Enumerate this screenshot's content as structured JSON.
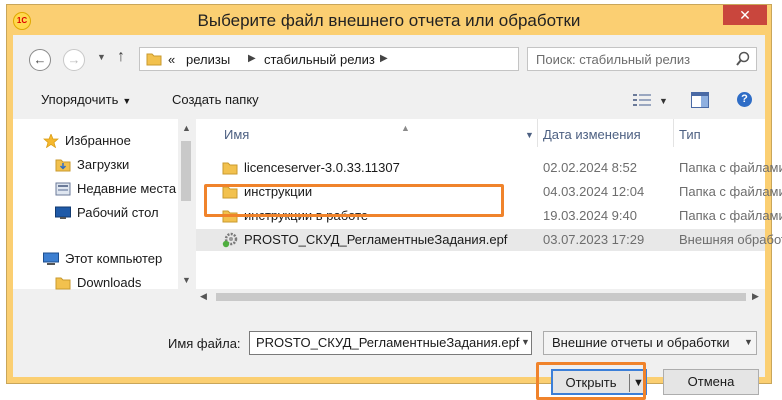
{
  "window": {
    "title": "Выберите файл внешнего отчета или обработки",
    "app_icon_text": "1С",
    "close_symbol": "✕"
  },
  "address_bar": {
    "overflow": "«",
    "segments": [
      "релизы",
      "стабильный релиз"
    ]
  },
  "search": {
    "placeholder": "Поиск: стабильный релиз"
  },
  "toolbar": {
    "organize_label": "Упорядочить",
    "new_folder_label": "Создать папку",
    "help_symbol": "?"
  },
  "nav_pane": {
    "items": [
      {
        "label": "Избранное",
        "icon": "star-icon"
      },
      {
        "label": "Загрузки",
        "icon": "downloads-folder-icon"
      },
      {
        "label": "Недавние места",
        "icon": "recent-places-icon"
      },
      {
        "label": "Рабочий стол",
        "icon": "desktop-icon"
      },
      {
        "label": "Этот компьютер",
        "icon": "computer-icon"
      },
      {
        "label": "Downloads",
        "icon": "folder-icon"
      }
    ]
  },
  "file_list": {
    "columns": {
      "name": "Имя",
      "date": "Дата изменения",
      "type": "Тип"
    },
    "rows": [
      {
        "name": "licenceserver-3.0.33.11307",
        "date": "02.02.2024 8:52",
        "type": "Папка с файлами",
        "icon": "folder-icon",
        "selected": false
      },
      {
        "name": "инструкции",
        "date": "04.03.2024 12:04",
        "type": "Папка с файлами",
        "icon": "folder-icon",
        "selected": false
      },
      {
        "name": "инструкции в работе",
        "date": "19.03.2024 9:40",
        "type": "Папка с файлами",
        "icon": "folder-icon",
        "selected": false
      },
      {
        "name": "PROSTO_СКУД_РегламентныеЗадания.epf",
        "date": "03.07.2023 17:29",
        "type": "Внешняя обработка",
        "icon": "epf-file-icon",
        "selected": true
      }
    ]
  },
  "bottom": {
    "filename_label": "Имя файла:",
    "filename_value": "PROSTO_СКУД_РегламентныеЗадания.epf",
    "filter_value": "Внешние отчеты и обработки",
    "open_label": "Открыть",
    "cancel_label": "Отмена"
  },
  "colors": {
    "window_frame": "#fbcf72",
    "close_button": "#c9463d",
    "annotation_highlight": "#f0832b",
    "selected_row": "#e8e8e8",
    "folder": "#f2c14e"
  }
}
